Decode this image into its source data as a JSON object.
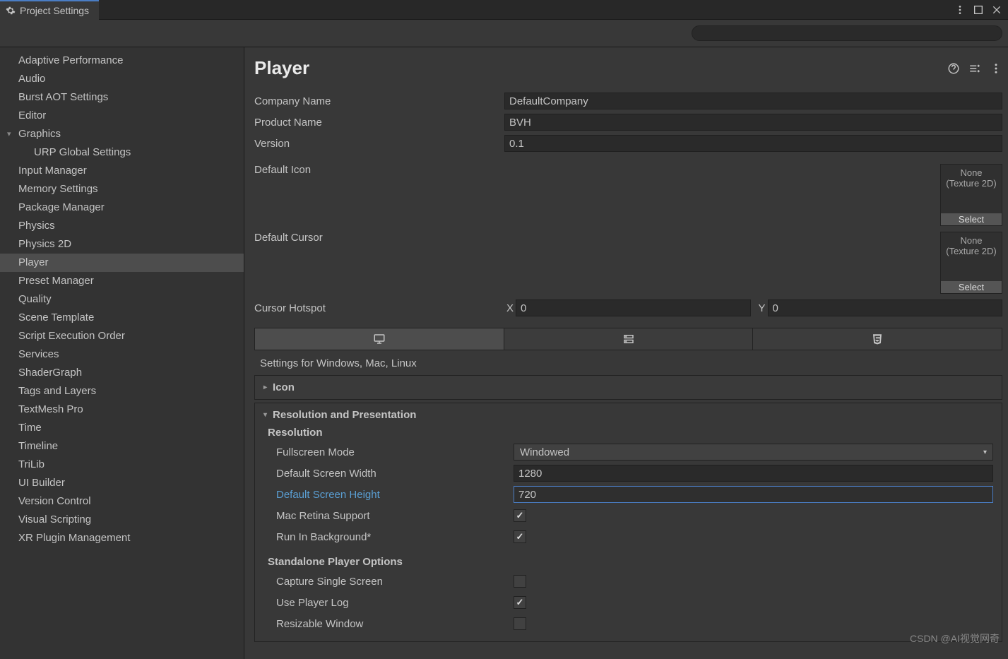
{
  "window": {
    "title": "Project Settings"
  },
  "sidebar": {
    "items": [
      {
        "label": "Adaptive Performance"
      },
      {
        "label": "Audio"
      },
      {
        "label": "Burst AOT Settings"
      },
      {
        "label": "Editor"
      },
      {
        "label": "Graphics",
        "expanded": true,
        "children": [
          {
            "label": "URP Global Settings"
          }
        ]
      },
      {
        "label": "Input Manager"
      },
      {
        "label": "Memory Settings"
      },
      {
        "label": "Package Manager"
      },
      {
        "label": "Physics"
      },
      {
        "label": "Physics 2D"
      },
      {
        "label": "Player",
        "selected": true
      },
      {
        "label": "Preset Manager"
      },
      {
        "label": "Quality"
      },
      {
        "label": "Scene Template"
      },
      {
        "label": "Script Execution Order"
      },
      {
        "label": "Services"
      },
      {
        "label": "ShaderGraph"
      },
      {
        "label": "Tags and Layers"
      },
      {
        "label": "TextMesh Pro"
      },
      {
        "label": "Time"
      },
      {
        "label": "Timeline"
      },
      {
        "label": "TriLib"
      },
      {
        "label": "UI Builder"
      },
      {
        "label": "Version Control"
      },
      {
        "label": "Visual Scripting"
      },
      {
        "label": "XR Plugin Management"
      }
    ]
  },
  "main": {
    "title": "Player",
    "company_name_label": "Company Name",
    "company_name": "DefaultCompany",
    "product_name_label": "Product Name",
    "product_name": "BVH",
    "version_label": "Version",
    "version": "0.1",
    "default_icon_label": "Default Icon",
    "default_cursor_label": "Default Cursor",
    "texture_none": "None",
    "texture_type": "(Texture 2D)",
    "texture_select": "Select",
    "cursor_hotspot_label": "Cursor Hotspot",
    "cursor_x_label": "X",
    "cursor_x": "0",
    "cursor_y_label": "Y",
    "cursor_y": "0",
    "platform_title": "Settings for Windows, Mac, Linux",
    "foldout_icon": "Icon",
    "section_res": "Resolution and Presentation",
    "subhead_res": "Resolution",
    "fullscreen_label": "Fullscreen Mode",
    "fullscreen_value": "Windowed",
    "width_label": "Default Screen Width",
    "width_value": "1280",
    "height_label": "Default Screen Height",
    "height_value": "720",
    "mac_retina_label": "Mac Retina Support",
    "run_bg_label": "Run In Background*",
    "subhead_standalone": "Standalone Player Options",
    "capture_label": "Capture Single Screen",
    "playerlog_label": "Use Player Log",
    "resizable_label": "Resizable Window"
  },
  "watermark": "CSDN @AI视觉网奇"
}
